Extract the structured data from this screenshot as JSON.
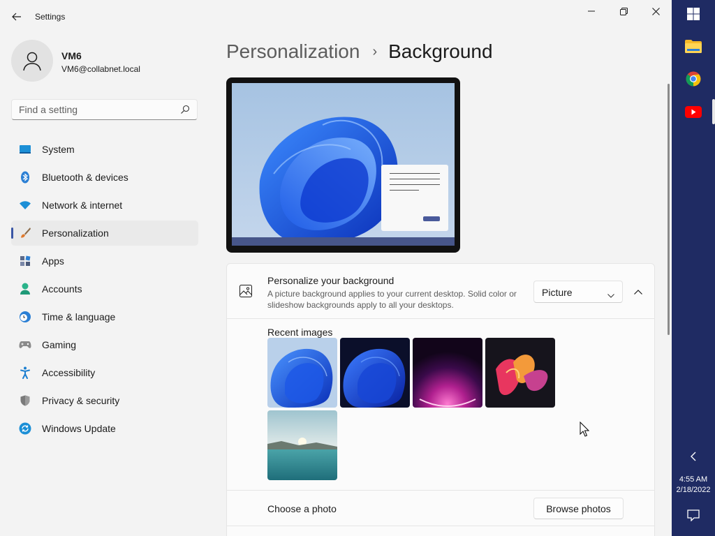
{
  "window": {
    "title": "Settings",
    "controls": {
      "minimize": "minimize",
      "restore": "restore",
      "close": "close"
    }
  },
  "user": {
    "name": "VM6",
    "email": "VM6@collabnet.local"
  },
  "search": {
    "placeholder": "Find a setting"
  },
  "sidebar": {
    "items": [
      {
        "label": "System",
        "icon": "system-icon"
      },
      {
        "label": "Bluetooth & devices",
        "icon": "bluetooth-icon"
      },
      {
        "label": "Network & internet",
        "icon": "wifi-icon"
      },
      {
        "label": "Personalization",
        "icon": "brush-icon",
        "selected": true
      },
      {
        "label": "Apps",
        "icon": "apps-icon"
      },
      {
        "label": "Accounts",
        "icon": "accounts-icon"
      },
      {
        "label": "Time & language",
        "icon": "clock-globe-icon"
      },
      {
        "label": "Gaming",
        "icon": "gamepad-icon"
      },
      {
        "label": "Accessibility",
        "icon": "accessibility-icon"
      },
      {
        "label": "Privacy & security",
        "icon": "shield-icon"
      },
      {
        "label": "Windows Update",
        "icon": "update-icon"
      }
    ]
  },
  "breadcrumb": {
    "parent": "Personalization",
    "separator": "›",
    "current": "Background"
  },
  "personalize": {
    "title": "Personalize your background",
    "description": "A picture background applies to your current desktop. Solid color or slideshow backgrounds apply to all your desktops.",
    "dropdown_value": "Picture"
  },
  "recent": {
    "label": "Recent images",
    "images": [
      "bloom-light",
      "bloom-dark",
      "glow-purple",
      "ribbons-colorful",
      "lake-sunrise"
    ]
  },
  "choose": {
    "label": "Choose a photo",
    "button": "Browse photos"
  },
  "taskbar": {
    "apps": [
      "windows-start-icon",
      "file-explorer-icon",
      "chrome-icon",
      "youtube-icon"
    ],
    "time": "4:55 AM",
    "date": "2/18/2022"
  },
  "colors": {
    "accent": "#3a56a5",
    "taskbar": "#1f2b63",
    "window_bg": "#f3f3f3"
  }
}
